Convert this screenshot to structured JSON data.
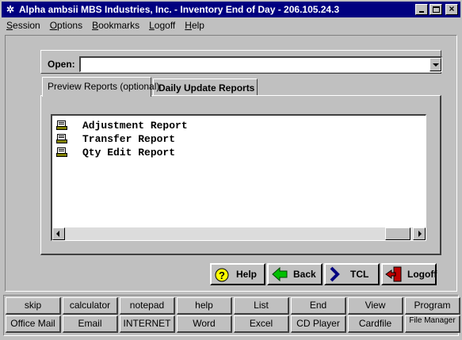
{
  "window": {
    "title": "Alpha ambsii MBS Industries, Inc. - Inventory End of Day - 206.105.24.3",
    "controls": {
      "minimize": "minimize",
      "maximize": "maximize",
      "close": "×"
    }
  },
  "menu": [
    {
      "label": "Session",
      "underline": "S",
      "rest": "ession"
    },
    {
      "label": "Options",
      "underline": "O",
      "rest": "ptions"
    },
    {
      "label": "Bookmarks",
      "underline": "B",
      "rest": "ookmarks"
    },
    {
      "label": "Logoff",
      "underline": "L",
      "rest": "ogoff"
    },
    {
      "label": "Help",
      "underline": "H",
      "rest": "elp"
    }
  ],
  "open": {
    "label": "Open:",
    "value": ""
  },
  "tabs": [
    {
      "label": "Preview Reports (optional)",
      "active": true
    },
    {
      "label": "Daily Update Reports",
      "active": false
    }
  ],
  "reports": [
    {
      "label": "Adjustment Report",
      "icon": "printer-report-icon"
    },
    {
      "label": "Transfer Report",
      "icon": "printer-report-icon"
    },
    {
      "label": "Qty Edit Report",
      "icon": "printer-report-icon"
    }
  ],
  "actions": {
    "help": "Help",
    "back": "Back",
    "tcl": "TCL",
    "logoff": "Logoff"
  },
  "toolbar": {
    "row1": [
      "skip",
      "calculator",
      "notepad",
      "help",
      "List",
      "End",
      "View",
      "Program"
    ],
    "row2": [
      "Office Mail",
      "Email",
      "INTERNET",
      "Word",
      "Excel",
      "CD Player",
      "Cardfile",
      "File Manager"
    ]
  },
  "colors": {
    "titlebar": "#000080",
    "face": "#c0c0c0",
    "help_icon": "#ffff00",
    "back_icon": "#00c000",
    "tcl_icon": "#000080",
    "logoff_icon": "#c00000"
  }
}
